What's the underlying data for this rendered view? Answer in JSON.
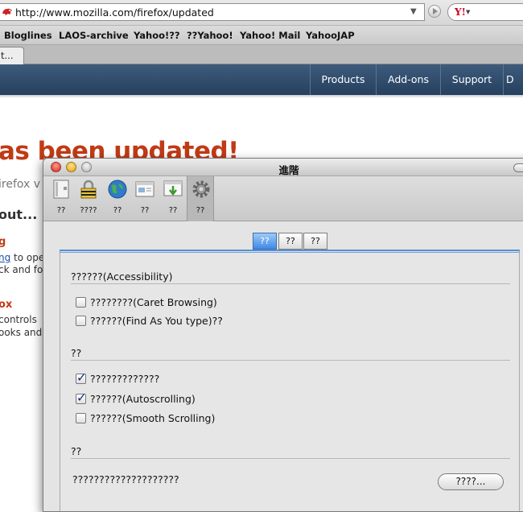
{
  "browser": {
    "url": "http://www.mozilla.com/firefox/updated",
    "search_engine_glyph": "Y!",
    "bookmarks": [
      "Bloglines",
      "LAOS-archive",
      "Yahoo!??",
      "??Yahoo!",
      "Yahoo! Mail",
      "YahooJAP"
    ],
    "tab_label": "t..."
  },
  "webpage": {
    "nav": [
      "Products",
      "Add-ons",
      "Support",
      "D"
    ],
    "heading": "as been updated!",
    "sub": "irefox v",
    "about": "out...",
    "red1": "g",
    "line1_link": "ng",
    "line1_rest": " to ope",
    "line2": "ck and for",
    "red2": "ox",
    "line3": " controls",
    "line4": "ooks and"
  },
  "dialog": {
    "title": "進階",
    "panes": [
      {
        "label": "??",
        "icon": "general-icon"
      },
      {
        "label": "????",
        "icon": "privacy-lock-icon"
      },
      {
        "label": "??",
        "icon": "globe-icon"
      },
      {
        "label": "??",
        "icon": "content-icon"
      },
      {
        "label": "??",
        "icon": "downloads-icon"
      },
      {
        "label": "??",
        "icon": "advanced-gear-icon"
      }
    ],
    "subtabs": [
      "??",
      "??",
      "??"
    ],
    "sections": {
      "accessibility_title": "??????(Accessibility)",
      "caret": "????????(Caret Browsing)",
      "find_as_you_type": "??????(Find As You type)??",
      "browsing_title": "??",
      "opt1": "?????????????",
      "autoscroll": "??????(Autoscrolling)",
      "smooth": "??????(Smooth Scrolling)",
      "lang_title": "??",
      "lang_desc": "????????????????????",
      "lang_button": "????..."
    },
    "checked": {
      "caret": false,
      "find": false,
      "opt1": true,
      "autoscroll": true,
      "smooth": false
    }
  },
  "colors": {
    "accent_red": "#c13a16",
    "nav_blue": "#2f4a6b",
    "selected_tab": "#3e8ae6"
  }
}
